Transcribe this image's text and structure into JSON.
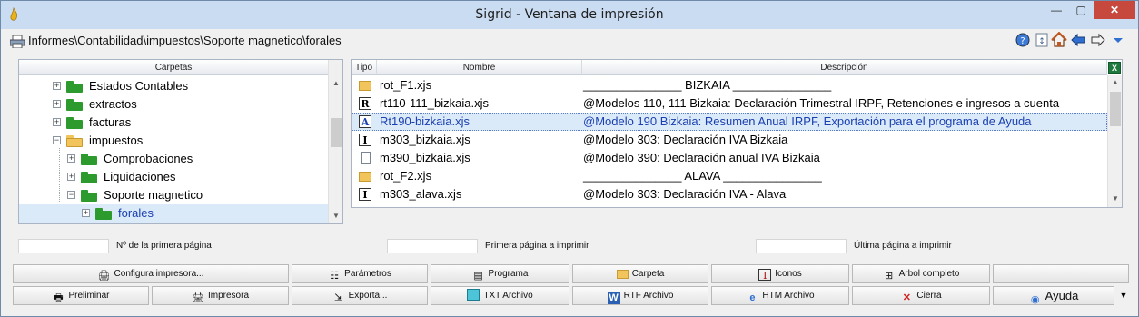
{
  "window": {
    "title": "Sigrid - Ventana de impresión",
    "minimize": "—",
    "maximize": "▢",
    "close": "✕"
  },
  "path": "Informes\\Contabilidad\\impuestos\\Soporte magnetico\\forales",
  "nav_icons": [
    "help-globe-icon",
    "refresh-icon",
    "home-icon",
    "back-arrow-icon",
    "forward-arrow-icon",
    "dropdown-icon"
  ],
  "folders_panel": {
    "header": "Carpetas",
    "items": [
      {
        "label": "Estados Contables",
        "expander": "+",
        "open": false
      },
      {
        "label": "extractos",
        "expander": "+",
        "open": false
      },
      {
        "label": "facturas",
        "expander": "+",
        "open": false
      },
      {
        "label": "impuestos",
        "expander": "−",
        "open": true
      },
      {
        "label": "Comprobaciones",
        "expander": "+",
        "open": false
      },
      {
        "label": "Liquidaciones",
        "expander": "+",
        "open": false
      },
      {
        "label": "Soporte magnetico",
        "expander": "−",
        "open": true
      },
      {
        "label": "forales",
        "expander": "+",
        "open": false,
        "selected": true
      }
    ]
  },
  "files_panel": {
    "columns": [
      "Tipo",
      "Nombre",
      "Descripción"
    ],
    "rows": [
      {
        "icon": "folder",
        "name": "rot_F1.xjs",
        "desc": "_______________  BIZKAIA  _______________"
      },
      {
        "icon": "R",
        "name": "rt110-111_bizkaia.xjs",
        "desc": "@Modelos 110, 111 Bizkaia: Declaración Trimestral IRPF, Retenciones e ingresos a cuenta"
      },
      {
        "icon": "A",
        "name": "Rt190-bizkaia.xjs",
        "desc": "@Modelo 190 Bizkaia: Resumen Anual IRPF, Exportación para el programa de Ayuda",
        "selected": true
      },
      {
        "icon": "I",
        "name": "m303_bizkaia.xjs",
        "desc": "@Modelo 303: Declaración IVA Bizkaia"
      },
      {
        "icon": "page",
        "name": "m390_bizkaia.xjs",
        "desc": "@Modelo 390: Declaración anual IVA Bizkaia"
      },
      {
        "icon": "folder",
        "name": "rot_F2.xjs",
        "desc": "_______________  ALAVA  _______________"
      },
      {
        "icon": "I",
        "name": "m303_alava.xjs",
        "desc": "@Modelo 303: Declaración IVA - Alava"
      }
    ]
  },
  "page_fields": {
    "first_page_number": {
      "label": "Nº de la primera página",
      "value": ""
    },
    "first_page_print": {
      "label": "Primera página a imprimir",
      "value": ""
    },
    "last_page_print": {
      "label": "Última página a imprimir",
      "value": ""
    }
  },
  "buttons_row1": [
    {
      "label": "Configura impresora...",
      "icon": "printer-setup-icon"
    },
    {
      "label": "Parámetros",
      "icon": "parameters-icon"
    },
    {
      "label": "Programa",
      "icon": "program-icon"
    },
    {
      "label": "Carpeta",
      "icon": "folder-icon"
    },
    {
      "label": "Iconos",
      "icon": "icons-icon"
    },
    {
      "label": "Arbol completo",
      "icon": "tree-icon"
    },
    {
      "label": "",
      "icon": ""
    }
  ],
  "buttons_row2": [
    {
      "label": "Preliminar",
      "icon": "preview-icon"
    },
    {
      "label": "Impresora",
      "icon": "printer-icon"
    },
    {
      "label": "Exporta...",
      "icon": "export-icon"
    },
    {
      "label": "TXT Archivo",
      "icon": "txt-icon"
    },
    {
      "label": "RTF Archivo",
      "icon": "rtf-icon"
    },
    {
      "label": "HTM Archivo",
      "icon": "htm-icon"
    },
    {
      "label": "Cierra",
      "icon": "close-x-icon"
    },
    {
      "label": "Ayuda",
      "icon": "help-icon"
    }
  ],
  "colors": {
    "titlebar": "#c9dcf1",
    "selection_bg": "#dbeaf8",
    "selection_text": "#1a3fb0",
    "close_button": "#c7483c"
  }
}
